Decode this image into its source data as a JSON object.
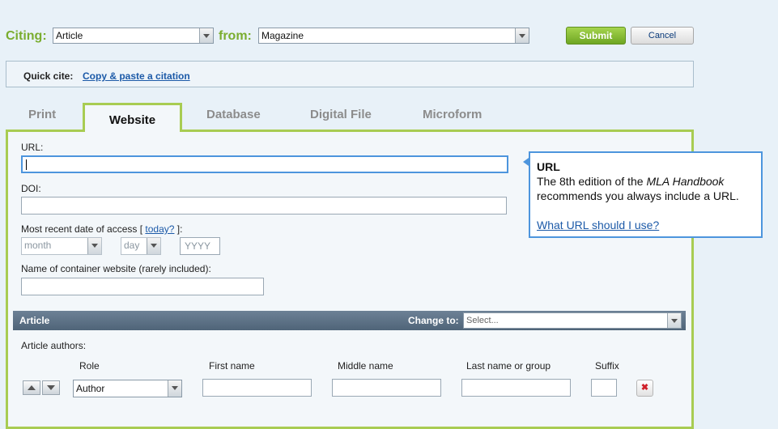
{
  "citing": {
    "label": "Citing:",
    "type_value": "Article",
    "from_label": "from:",
    "source_value": "Magazine"
  },
  "actions": {
    "submit": "Submit",
    "cancel": "Cancel"
  },
  "quick_cite": {
    "label": "Quick cite:",
    "link": "Copy & paste a citation"
  },
  "tabs": [
    {
      "label": "Print",
      "active": false
    },
    {
      "label": "Website",
      "active": true
    },
    {
      "label": "Database",
      "active": false
    },
    {
      "label": "Digital File",
      "active": false
    },
    {
      "label": "Microform",
      "active": false
    }
  ],
  "form": {
    "url_label": "URL:",
    "url_value": "",
    "doi_label": "DOI:",
    "doi_value": "",
    "access_label_prefix": "Most recent date of access [",
    "access_today": "today?",
    "access_label_suffix": "]:",
    "month_placeholder": "month",
    "day_placeholder": "day",
    "year_placeholder": "YYYY",
    "container_label": "Name of container website (rarely included):",
    "container_value": ""
  },
  "tooltip": {
    "title": "URL",
    "text_before": "The 8th edition of the ",
    "text_italic": "MLA Handbook",
    "text_after": " recommends you always include a URL.",
    "link": "What URL should I use?"
  },
  "article_section": {
    "title": "Article",
    "change_to_label": "Change to:",
    "change_to_placeholder": "Select..."
  },
  "authors": {
    "label": "Article authors:",
    "columns": [
      "Role",
      "First name",
      "Middle name",
      "Last name or group",
      "Suffix"
    ],
    "role_value": "Author",
    "remove_glyph": "✖"
  },
  "colors": {
    "accent_green": "#7aad2f",
    "tab_border": "#a8cc52",
    "link_blue": "#1c5aa8",
    "focus_blue": "#4d95dd",
    "bar_gray": "#5a6f84"
  }
}
